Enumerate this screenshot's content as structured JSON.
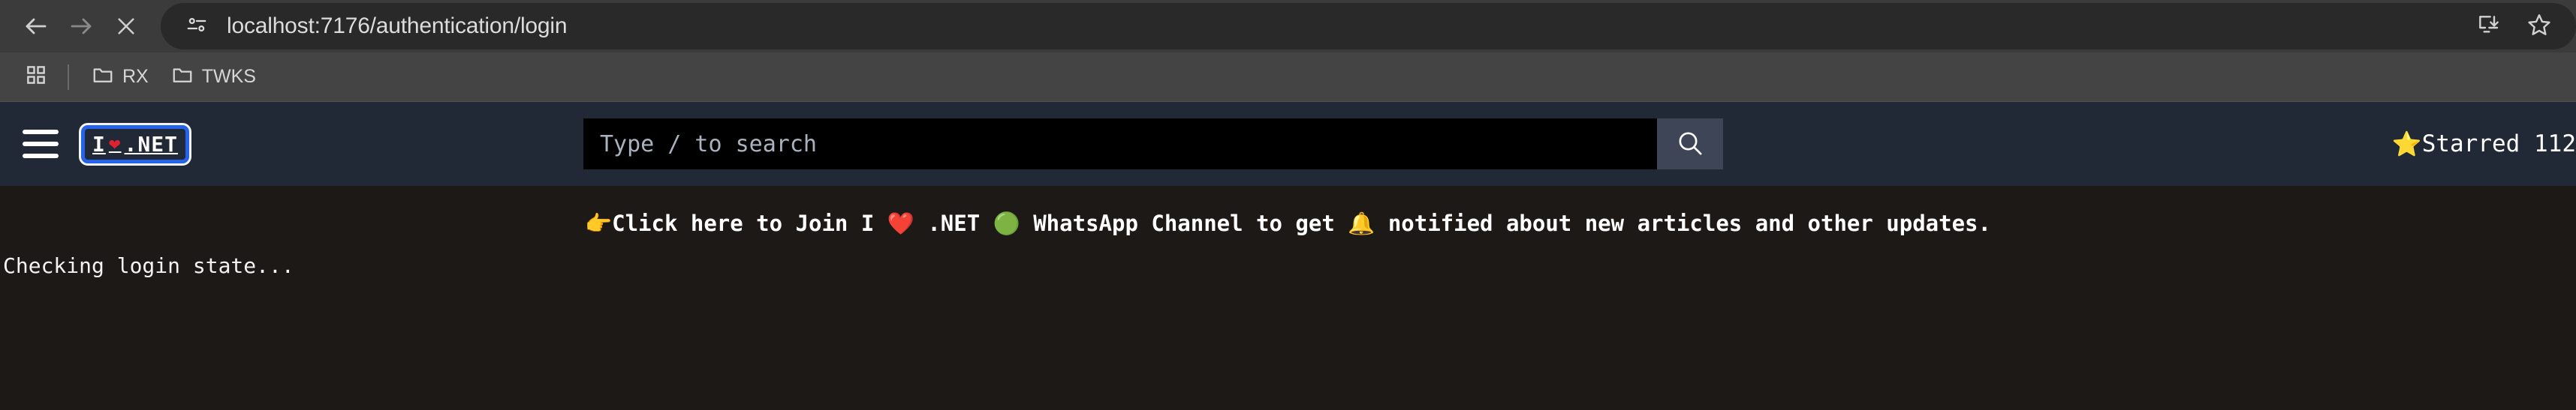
{
  "browser": {
    "back_icon": "arrow-left-icon",
    "forward_icon": "arrow-right-icon",
    "stop_icon": "close-x-icon",
    "site_info_icon": "tune-settings-icon",
    "url": "localhost:7176/authentication/login",
    "install_icon": "install-app-icon",
    "bookmark_icon": "star-outline-icon",
    "bookmarks": {
      "apps_icon": "apps-grid-icon",
      "items": [
        {
          "label": "RX",
          "icon": "folder-icon"
        },
        {
          "label": "TWKS",
          "icon": "folder-icon"
        }
      ]
    }
  },
  "site_header": {
    "menu_icon": "hamburger-menu-icon",
    "brand": {
      "prefix": "I",
      "heart": "❤",
      "suffix": ".NET"
    },
    "search": {
      "placeholder": "Type / to search",
      "value": "",
      "button_icon": "search-icon"
    },
    "starred": {
      "icon": "⭐",
      "label": "Starred 112"
    }
  },
  "page": {
    "promo_banner": {
      "pointer_emoji": "👉",
      "text_before_heart": "Click here to Join I ",
      "heart_emoji": "❤️",
      "text_after_heart": " .NET ",
      "whatsapp_emoji": "🟢",
      "text_middle": " WhatsApp Channel to get ",
      "bell_emoji": "🔔",
      "text_end": " notified about new articles and other updates."
    },
    "status_text": "Checking login state..."
  },
  "colors": {
    "toolbar_bg": "#3b3b3b",
    "omnibox_bg": "#292929",
    "bookmarks_bg": "#444444",
    "site_header_bg": "#212936",
    "body_bg": "#1c1917",
    "search_input_bg": "#000000",
    "search_btn_bg": "#3d4557",
    "focus_ring": "#2563eb",
    "heart_red": "#e0212e",
    "star_gold": "#d4af37"
  }
}
